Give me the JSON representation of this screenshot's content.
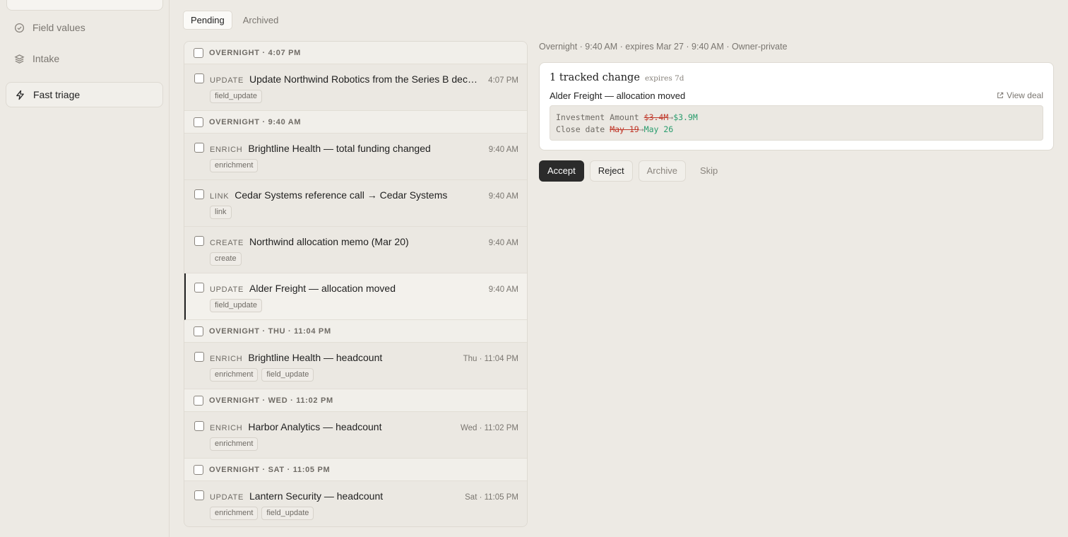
{
  "sidebar": {
    "items": [
      {
        "label": "Field values",
        "icon": "check-circle-icon"
      },
      {
        "label": "Intake",
        "icon": "layers-icon"
      },
      {
        "label": "Fast triage",
        "icon": "lightning-icon",
        "active": true
      }
    ]
  },
  "tabs": [
    {
      "label": "Pending",
      "active": true
    },
    {
      "label": "Archived",
      "active": false
    }
  ],
  "groups": [
    {
      "label": "OVERNIGHT · 4:07 PM",
      "items": [
        {
          "kind": "UPDATE",
          "title": "Update Northwind Robotics from the Series B deck ...",
          "time": "4:07 PM",
          "tags": [
            "field_update"
          ]
        }
      ]
    },
    {
      "label": "OVERNIGHT · 9:40 AM",
      "items": [
        {
          "kind": "ENRICH",
          "title": "Brightline Health — total funding changed",
          "time": "9:40 AM",
          "tags": [
            "enrichment"
          ]
        },
        {
          "kind": "LINK",
          "title": "Cedar Systems reference call → Cedar Systems",
          "time": "9:40 AM",
          "tags": [
            "link"
          ]
        },
        {
          "kind": "CREATE",
          "title": "Northwind allocation memo (Mar 20)",
          "time": "9:40 AM",
          "tags": [
            "create"
          ]
        },
        {
          "kind": "UPDATE",
          "title": "Alder Freight — allocation moved",
          "time": "9:40 AM",
          "tags": [
            "field_update"
          ],
          "selected": true
        }
      ]
    },
    {
      "label": "OVERNIGHT · THU · 11:04 PM",
      "items": [
        {
          "kind": "ENRICH",
          "title": "Brightline Health — headcount",
          "time": "Thu · 11:04 PM",
          "tags": [
            "enrichment",
            "field_update"
          ]
        }
      ]
    },
    {
      "label": "OVERNIGHT · WED · 11:02 PM",
      "items": [
        {
          "kind": "ENRICH",
          "title": "Harbor Analytics — headcount",
          "time": "Wed · 11:02 PM",
          "tags": [
            "enrichment"
          ]
        }
      ]
    },
    {
      "label": "OVERNIGHT · SAT · 11:05 PM",
      "items": [
        {
          "kind": "UPDATE",
          "title": "Lantern Security — headcount",
          "time": "Sat · 11:05 PM",
          "tags": [
            "enrichment",
            "field_update"
          ]
        }
      ]
    }
  ],
  "detail": {
    "meta": "Overnight · 9:40 AM · expires Mar 27 · 9:40 AM · Owner-private",
    "card": {
      "title": "1 tracked change",
      "expires": "expires 7d",
      "subtitle": "Alder Freight — allocation moved",
      "view_deal": "View deal",
      "changes": [
        {
          "field": "Investment Amount",
          "old": "$3.4M",
          "new": "$3.9M"
        },
        {
          "field": "Close date",
          "old": "May 19",
          "new": "May 26"
        }
      ],
      "arrow": "→"
    },
    "actions": {
      "accept": "Accept",
      "reject": "Reject",
      "archive": "Archive",
      "skip": "Skip"
    }
  },
  "colors": {
    "old": "#c0392b",
    "new": "#2a9d6e",
    "primary": "#2b2b2b"
  }
}
